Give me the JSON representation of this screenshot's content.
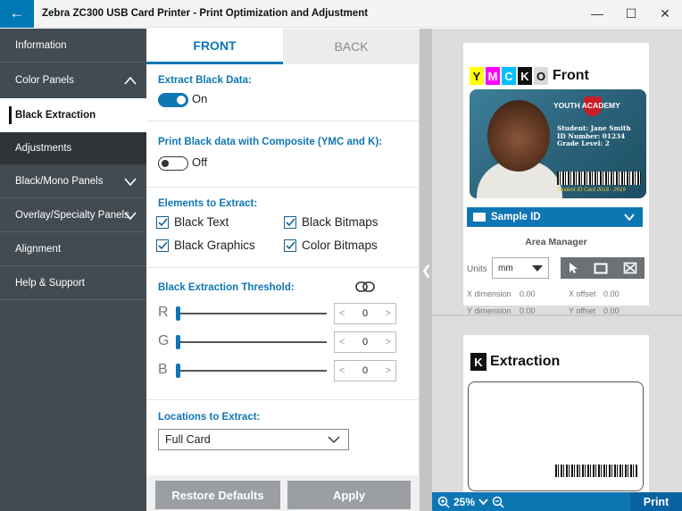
{
  "window": {
    "title": "Zebra ZC300 USB Card Printer - Print Optimization and Adjustment",
    "back_icon": "arrow-left-icon",
    "minimize": "—",
    "maximize": "☐",
    "close": "✕"
  },
  "sidebar": {
    "items": [
      {
        "label": "Information"
      },
      {
        "label": "Color Panels",
        "expanded": true
      },
      {
        "label": "Black Extraction",
        "active": true
      },
      {
        "label": "Adjustments"
      },
      {
        "label": "Black/Mono Panels"
      },
      {
        "label": "Overlay/Specialty Panels"
      },
      {
        "label": "Alignment"
      },
      {
        "label": "Help & Support"
      }
    ]
  },
  "tabs": {
    "front": "FRONT",
    "back": "BACK",
    "active": "FRONT"
  },
  "extract_black": {
    "title": "Extract Black Data:",
    "state": "On",
    "on": true
  },
  "print_black": {
    "title": "Print Black data with Composite (YMC and K):",
    "state": "Off",
    "on": false
  },
  "elements": {
    "title": "Elements to Extract:",
    "black_text": {
      "label": "Black Text",
      "checked": true
    },
    "black_bitmaps": {
      "label": "Black Bitmaps",
      "checked": true
    },
    "black_graphics": {
      "label": "Black Graphics",
      "checked": true
    },
    "color_bitmaps": {
      "label": "Color Bitmaps",
      "checked": true
    }
  },
  "threshold": {
    "title": "Black Extraction Threshold:",
    "link_icon": "link-icon",
    "r": {
      "label": "R",
      "value": "0"
    },
    "g": {
      "label": "G",
      "value": "0"
    },
    "b": {
      "label": "B",
      "value": "0"
    },
    "dec": "<",
    "inc": ">"
  },
  "locations": {
    "title": "Locations to Extract:",
    "value": "Full Card"
  },
  "buttons": {
    "restore": "Restore Defaults",
    "apply": "Apply"
  },
  "preview": {
    "panels": {
      "y": "Y",
      "m": "M",
      "c": "C",
      "k": "K",
      "o": "O",
      "side": "Front"
    },
    "card": {
      "school": "YOUTH ACADEMY",
      "student": "Student: Jane Smith",
      "id": "ID Number: 01234",
      "grade": "Grade Level: 2",
      "footer": "Student ID Card 2018 - 2019"
    },
    "sample_id": "Sample ID",
    "area_manager": "Area Manager",
    "units_label": "Units",
    "units_value": "mm",
    "x_dimension": {
      "label": "X dimension",
      "value": "0.00"
    },
    "x_offset": {
      "label": "X offset",
      "value": "0.00"
    },
    "y_dimension": {
      "label": "Y dimension",
      "value": "0.00"
    },
    "y_offset": {
      "label": "Y offset",
      "value": "0.00"
    },
    "extraction": {
      "k": "K",
      "label": "Extraction"
    },
    "zoom": "25%",
    "print": "Print"
  },
  "colors": {
    "accent": "#0f76b4",
    "nav_bg": "#434b52",
    "yellow": "#ffff00",
    "magenta": "#ff00ff",
    "cyan": "#00c0ff",
    "black": "#111111",
    "overlay": "#d9d9d9"
  }
}
